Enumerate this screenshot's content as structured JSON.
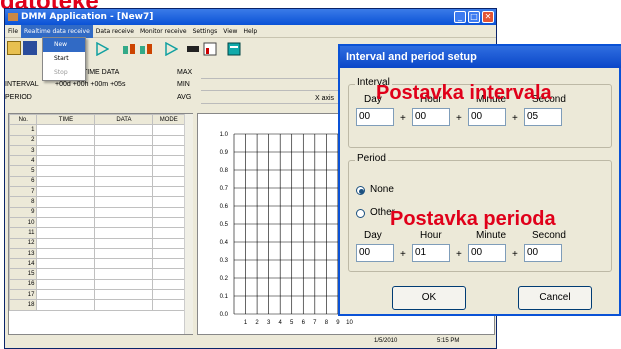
{
  "overlay": {
    "top_title": "datoteke",
    "interval_caption": "Postavka intervala",
    "period_caption": "Postavka perioda"
  },
  "main_window": {
    "title": "DMM Application - [New7]",
    "menu": [
      "File",
      "Realtime data receive",
      "Data receive",
      "Monitor receive",
      "Settings",
      "View",
      "Help"
    ],
    "menu_right": "_  \u0018  x",
    "dropdown": [
      "New",
      "Start",
      "Stop"
    ],
    "time_data_label": "TIME DATA",
    "interval_label": "INTERVAL",
    "interval_value": "+00d +00h +00m +05s",
    "period_label": "PERIOD",
    "max_label": "MAX",
    "min_label": "MIN",
    "avg_label": "AVG",
    "xaxis_label": "X axis",
    "table": {
      "headers": [
        "No.",
        "TIME",
        "DATA",
        "MODE"
      ],
      "rows": [
        "1",
        "2",
        "3",
        "4",
        "5",
        "6",
        "7",
        "8",
        "9",
        "10",
        "11",
        "12",
        "13",
        "14",
        "15",
        "16",
        "17",
        "18"
      ]
    },
    "status": {
      "date": "1/5/2010",
      "time": "5:15 PM"
    }
  },
  "chart_data": {
    "type": "line",
    "y_ticks": [
      "1.0",
      "0.9",
      "0.8",
      "0.7",
      "0.6",
      "0.5",
      "0.4",
      "0.3",
      "0.2",
      "0.1",
      "0.0"
    ],
    "x_ticks": [
      "1",
      "2",
      "3",
      "4",
      "5",
      "6",
      "7",
      "8",
      "9",
      "10"
    ],
    "ylim": [
      0,
      1.0
    ],
    "grid": true,
    "series": []
  },
  "dialog": {
    "title": "Interval and period setup",
    "interval_group": "Interval",
    "period_group": "Period",
    "col_labels": [
      "Day",
      "Hour",
      "Minute",
      "Second"
    ],
    "interval_values": [
      "00",
      "00",
      "00",
      "05"
    ],
    "radio_none": "None",
    "radio_other": "Other",
    "period_values": [
      "00",
      "01",
      "00",
      "00"
    ],
    "plus": "+",
    "ok": "OK",
    "cancel": "Cancel"
  }
}
